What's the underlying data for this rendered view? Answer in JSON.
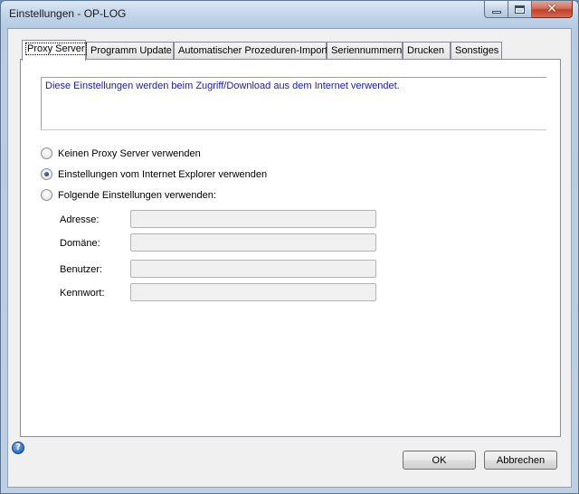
{
  "window": {
    "title": "Einstellungen - OP-LOG"
  },
  "icons": {
    "minimize": "minimize-icon",
    "maximize": "maximize-icon",
    "close": "close-icon",
    "help": "help-icon"
  },
  "tabs": [
    {
      "label": "Proxy Server",
      "active": true
    },
    {
      "label": "Programm Update",
      "active": false
    },
    {
      "label": "Automatischer Prozeduren-Import",
      "active": false
    },
    {
      "label": "Seriennummern",
      "active": false
    },
    {
      "label": "Drucken",
      "active": false
    },
    {
      "label": "Sonstiges",
      "active": false
    }
  ],
  "proxy": {
    "info_text": "Diese Einstellungen werden beim Zugriff/Download aus dem Internet verwendet.",
    "options": [
      {
        "label": "Keinen Proxy Server verwenden",
        "selected": false
      },
      {
        "label": "Einstellungen vom Internet Explorer verwenden",
        "selected": true
      },
      {
        "label": "Folgende Einstellungen verwenden:",
        "selected": false
      }
    ],
    "fields": [
      {
        "label": "Adresse:",
        "value": ""
      },
      {
        "label": "Domäne:",
        "value": ""
      },
      {
        "label": "Benutzer:",
        "value": ""
      },
      {
        "label": "Kennwort:",
        "value": ""
      }
    ]
  },
  "buttons": {
    "ok": "OK",
    "cancel": "Abbrechen"
  },
  "colors": {
    "info_text": "#1a1aa6",
    "close_button": "#c0412a"
  }
}
